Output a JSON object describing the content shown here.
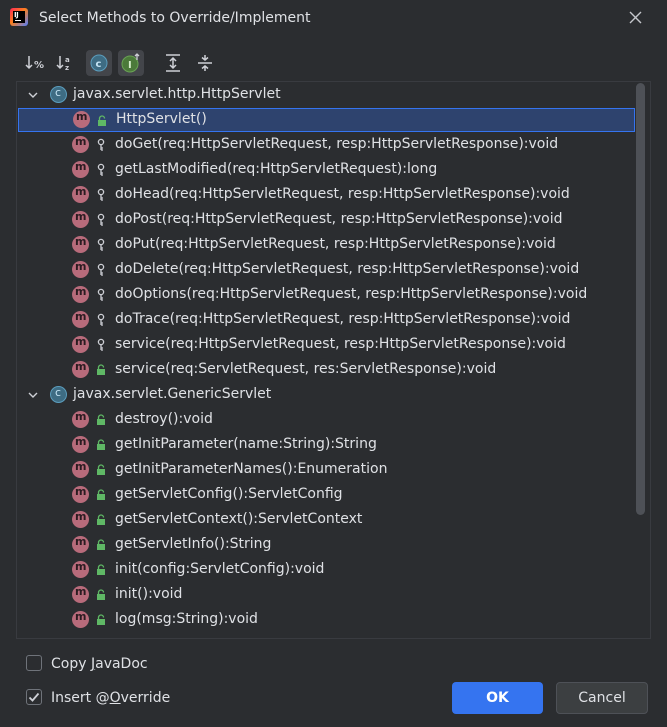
{
  "window": {
    "title": "Select Methods to Override/Implement"
  },
  "toolbar": {
    "buttons": [
      {
        "icon": "sort-by-visibility-icon"
      },
      {
        "icon": "sort-alphabetically-icon"
      },
      {
        "icon": "show-classes-icon",
        "active": true
      },
      {
        "icon": "show-interfaces-icon",
        "active": true
      },
      {
        "icon": "expand-all-icon"
      },
      {
        "icon": "collapse-all-icon"
      }
    ]
  },
  "tree": {
    "groups": [
      {
        "name": "javax.servlet.http.HttpServlet",
        "methods": [
          {
            "label": "HttpServlet()",
            "access": "public",
            "selected": true
          },
          {
            "label": "doGet(req:HttpServletRequest, resp:HttpServletResponse):void",
            "access": "protected"
          },
          {
            "label": "getLastModified(req:HttpServletRequest):long",
            "access": "protected"
          },
          {
            "label": "doHead(req:HttpServletRequest, resp:HttpServletResponse):void",
            "access": "protected"
          },
          {
            "label": "doPost(req:HttpServletRequest, resp:HttpServletResponse):void",
            "access": "protected"
          },
          {
            "label": "doPut(req:HttpServletRequest, resp:HttpServletResponse):void",
            "access": "protected"
          },
          {
            "label": "doDelete(req:HttpServletRequest, resp:HttpServletResponse):void",
            "access": "protected"
          },
          {
            "label": "doOptions(req:HttpServletRequest, resp:HttpServletResponse):void",
            "access": "protected"
          },
          {
            "label": "doTrace(req:HttpServletRequest, resp:HttpServletResponse):void",
            "access": "protected"
          },
          {
            "label": "service(req:HttpServletRequest, resp:HttpServletResponse):void",
            "access": "protected"
          },
          {
            "label": "service(req:ServletRequest, res:ServletResponse):void",
            "access": "public"
          }
        ]
      },
      {
        "name": "javax.servlet.GenericServlet",
        "methods": [
          {
            "label": "destroy():void",
            "access": "public"
          },
          {
            "label": "getInitParameter(name:String):String",
            "access": "public"
          },
          {
            "label": "getInitParameterNames():Enumeration",
            "access": "public"
          },
          {
            "label": "getServletConfig():ServletConfig",
            "access": "public"
          },
          {
            "label": "getServletContext():ServletContext",
            "access": "public"
          },
          {
            "label": "getServletInfo():String",
            "access": "public"
          },
          {
            "label": "init(config:ServletConfig):void",
            "access": "public"
          },
          {
            "label": "init():void",
            "access": "public"
          },
          {
            "label": "log(msg:String):void",
            "access": "public"
          }
        ]
      }
    ]
  },
  "options": {
    "copy_javadoc": {
      "label_before": "Copy ",
      "mnemonic": "J",
      "label_after": "avaDoc",
      "checked": false
    },
    "insert_override": {
      "label_before": "Insert @",
      "mnemonic": "O",
      "label_after": "verride",
      "checked": true
    }
  },
  "buttons": {
    "ok": "OK",
    "cancel": "Cancel"
  },
  "colors": {
    "background": "#2b2d30",
    "selection": "#2e436e",
    "accent": "#3574f0",
    "method_icon": "#b86b7b",
    "class_icon": "#3e6c83",
    "lock_green": "#5fb865"
  }
}
